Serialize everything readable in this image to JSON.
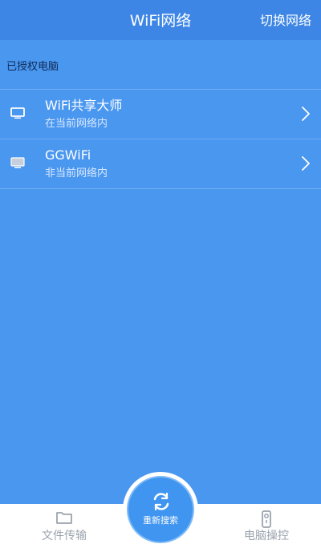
{
  "header": {
    "title": "WiFi网络",
    "switch_network": "切换网络"
  },
  "section": {
    "label": "已授权电脑"
  },
  "devices": [
    {
      "name": "WiFi共享大师",
      "status": "在当前网络内",
      "icon": "monitor-icon"
    },
    {
      "name": "GGWiFi",
      "status": "非当前网络内",
      "icon": "monitor-icon"
    }
  ],
  "bottom_bar": {
    "left_label": "文件传输",
    "right_label": "电脑操控",
    "center_label": "重新搜索",
    "left_icon": "folder-icon",
    "right_icon": "remote-control-icon",
    "center_icon": "refresh-icon"
  },
  "colors": {
    "header": "#3d86e6",
    "background": "#4a97f0",
    "accent": "#3f95ef",
    "tab_text": "#9aa3ad"
  }
}
